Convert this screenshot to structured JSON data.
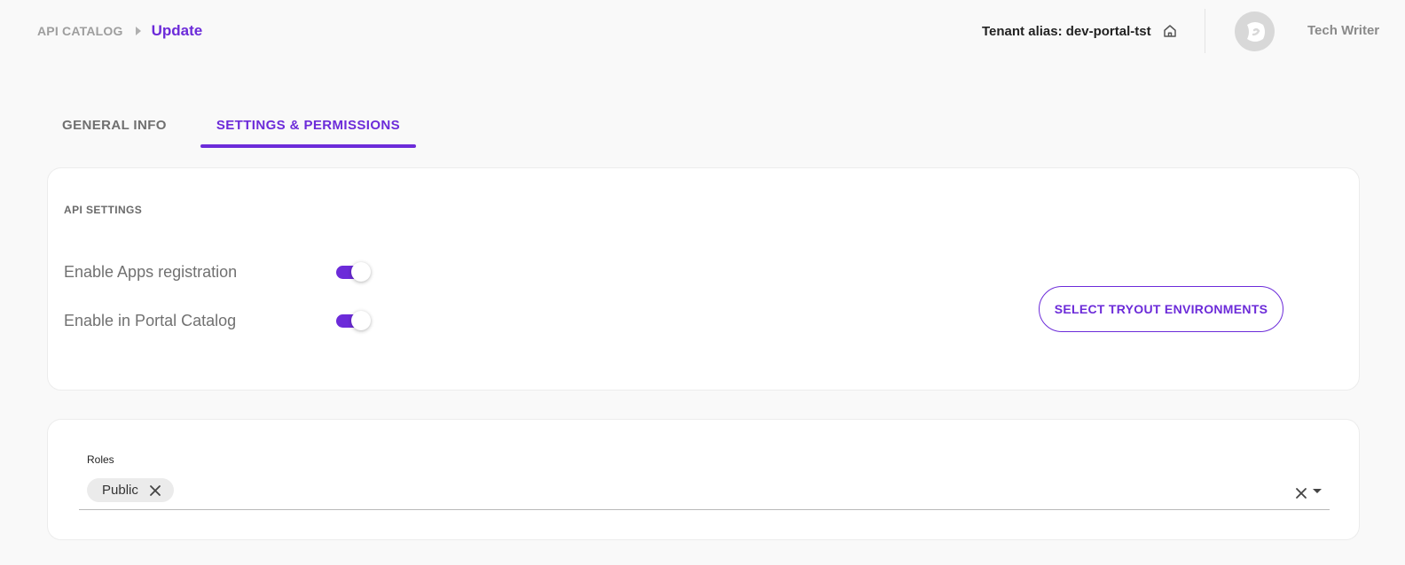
{
  "breadcrumb": {
    "root": "API CATALOG",
    "current": "Update"
  },
  "header": {
    "tenant": "Tenant alias: dev-portal-tst",
    "username": "Tech Writer"
  },
  "tabs": [
    {
      "label": "GENERAL INFO",
      "active": false
    },
    {
      "label": "SETTINGS & PERMISSIONS",
      "active": true
    }
  ],
  "api_settings": {
    "title": "API SETTINGS",
    "toggles": [
      {
        "label": "Enable Apps registration",
        "on": true
      },
      {
        "label": "Enable in Portal Catalog",
        "on": true
      }
    ],
    "tryout_button": "SELECT TRYOUT ENVIRONMENTS"
  },
  "roles": {
    "label": "Roles",
    "chips": [
      "Public"
    ]
  },
  "colors": {
    "accent": "#6c2bd9",
    "background": "#f9f9f9",
    "chip": "#ebebeb"
  },
  "icons": [
    "home-icon",
    "avatar-logo-icon",
    "close-icon",
    "chevron-down-icon"
  ]
}
